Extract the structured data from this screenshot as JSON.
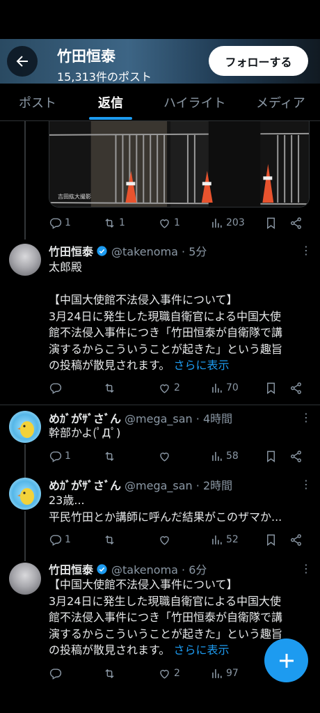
{
  "header": {
    "name": "竹田恒泰",
    "post_count": "15,313件のポスト",
    "follow_label": "フォローする"
  },
  "tabs": [
    "ポスト",
    "返信",
    "ハイライト",
    "メディア"
  ],
  "active_tab": "返信",
  "colors": {
    "accent": "#1d9bf0",
    "background": "#000000",
    "muted": "#8b98a5"
  },
  "media_caption": "吉田紘大撮影",
  "first_actions": {
    "reply": "1",
    "repost": "1",
    "like": "1",
    "views": "203"
  },
  "posts": [
    {
      "name": "竹田恒泰",
      "verified": true,
      "handle_time": "@takenoma · 5分",
      "lines": [
        "太郎殿",
        "",
        "【中国大使館不法侵入事件について】",
        "3月24日に発生した現職自衛官による中国大使",
        "館不法侵入事件につき「竹田恒泰が自衛隊で講",
        "演するからこういうことが起きた」という趣旨",
        "の投稿が散見されます。"
      ],
      "more_link": "さらに表示",
      "actions": {
        "reply": "",
        "repost": "",
        "like": "2",
        "views": "70"
      }
    },
    {
      "name": "めｶﾞがｻﾞさﾞん",
      "verified": false,
      "handle_time": "@mega_san · 4時間",
      "lines": [
        "幹部かよ(ﾟДﾟ)"
      ],
      "actions": {
        "reply": "1",
        "repost": "",
        "like": "",
        "views": "58"
      }
    },
    {
      "name": "めｶﾞがｻﾞさﾞん",
      "verified": false,
      "handle_time": "@mega_san · 2時間",
      "lines": [
        "23歳...",
        "平民竹田とか講師に呼んだ結果がこのザマか..."
      ],
      "actions": {
        "reply": "1",
        "repost": "",
        "like": "",
        "views": "52"
      }
    },
    {
      "name": "竹田恒泰",
      "verified": true,
      "handle_time": "@takenoma · 6分",
      "lines": [
        "【中国大使館不法侵入事件について】",
        "3月24日に発生した現職自衛官による中国大使",
        "館不法侵入事件につき「竹田恒泰が自衛隊で講",
        "演するからこういうことが起きた」という趣旨",
        "の投稿が散見されます。"
      ],
      "more_link": "さらに表示",
      "actions": {
        "reply": "",
        "repost": "",
        "like": "2",
        "views": "97"
      }
    }
  ]
}
